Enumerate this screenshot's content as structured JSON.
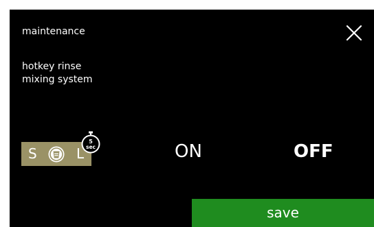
{
  "header": {
    "title": "maintenance",
    "close_icon": "close-icon"
  },
  "content": {
    "subtitle_line1": "hotkey rinse",
    "subtitle_line2": "mixing system"
  },
  "hotkey": {
    "small_label": "S",
    "large_label": "L",
    "cup_icon": "cup-icon",
    "timer_icon": "stopwatch-icon",
    "timer_value": "5",
    "timer_unit": "sec",
    "panel_color": "#9a9266"
  },
  "options": {
    "on_label": "ON",
    "off_label": "OFF",
    "selected": "OFF"
  },
  "footer": {
    "save_label": "save",
    "save_color": "#1f8c1f"
  }
}
